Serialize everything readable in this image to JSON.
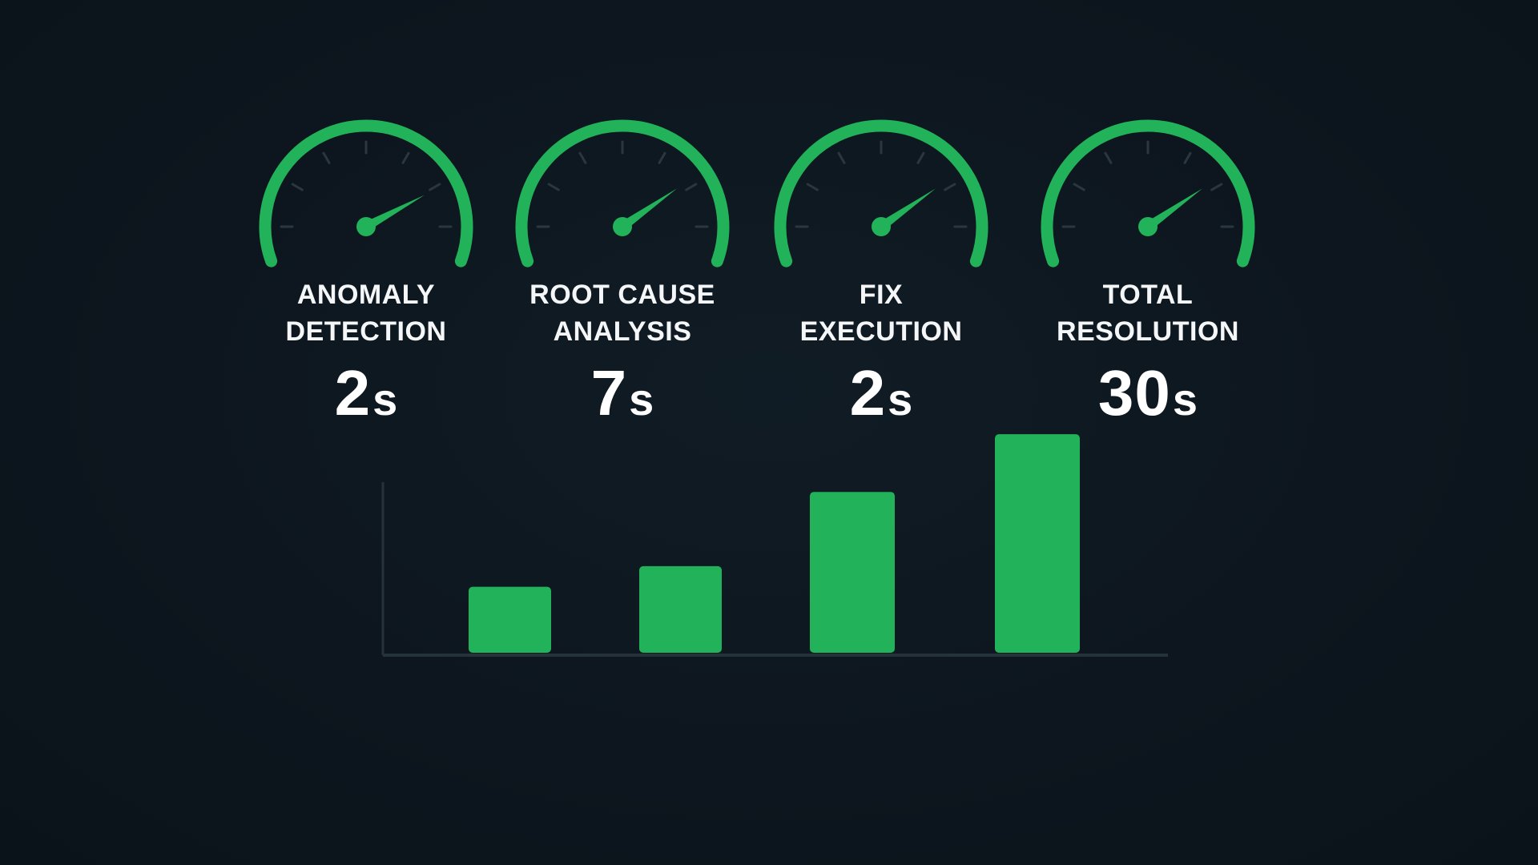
{
  "colors": {
    "background": "#0d161e",
    "accent": "#22b35a",
    "tick": "#2b3740",
    "axis": "#26323a",
    "text": "#f4f6f7"
  },
  "gauges": [
    {
      "label": "ANOMALY\nDETECTION",
      "value": "2",
      "unit": "s",
      "needle_level": 0.78
    },
    {
      "label": "ROOT CAUSE\nANALYSIS",
      "value": "7",
      "unit": "s",
      "needle_level": 0.75
    },
    {
      "label": "FIX\nEXECUTION",
      "value": "2",
      "unit": "s",
      "needle_level": 0.75
    },
    {
      "label": "TOTAL\nRESOLUTION",
      "value": "30",
      "unit": "s",
      "needle_level": 0.75
    }
  ],
  "chart_data": {
    "type": "bar",
    "categories": [
      "",
      "",
      "",
      ""
    ],
    "values": [
      8,
      10.5,
      19.5,
      26.5
    ],
    "ylim": [
      0,
      27
    ],
    "grid": false,
    "title": "",
    "xlabel": "",
    "ylabel": ""
  }
}
